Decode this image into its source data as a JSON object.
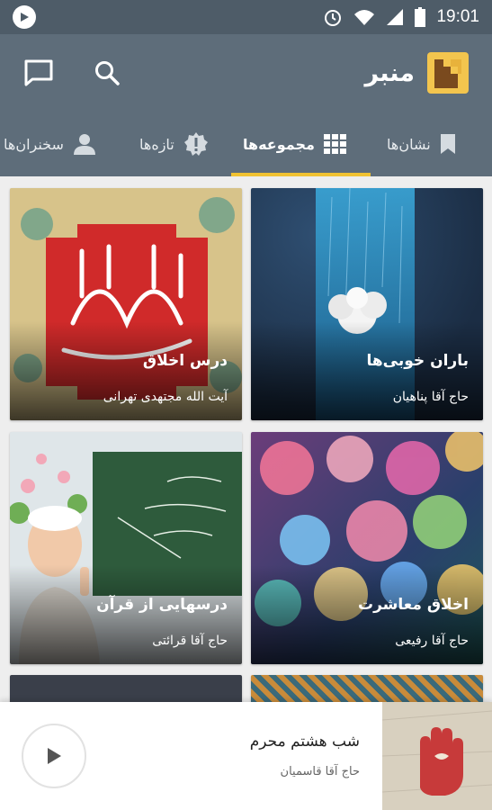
{
  "status_bar": {
    "time": "19:01"
  },
  "app": {
    "title": "منبر"
  },
  "tabs": [
    {
      "label": "نشان‌ها"
    },
    {
      "label": "مجموعه‌ها"
    },
    {
      "label": "تازه‌ها"
    },
    {
      "label": "سخنران‌ها"
    }
  ],
  "colors": {
    "toolbar": "#5e6d7a",
    "status_bar": "#4e5c68",
    "accent": "#f1c232"
  },
  "cards": [
    {
      "title": "باران خوبی‌ها",
      "subtitle": "حاج آقا پناهیان"
    },
    {
      "title": "درس اخلاق",
      "subtitle": "آیت الله مجتهدی تهرانی"
    },
    {
      "title": "اخلاق معاشرت",
      "subtitle": "حاج آقا رفیعی"
    },
    {
      "title": "درسهایی از قرآن",
      "subtitle": "حاج آقا قرائتی"
    }
  ],
  "player": {
    "title": "شب هشتم محرم",
    "subtitle": "حاج آقا قاسمیان"
  },
  "icons": [
    "play-circle-icon",
    "alarm-icon",
    "wifi-icon",
    "signal-icon",
    "battery-icon",
    "chat-icon",
    "search-icon",
    "bookmark-icon",
    "grid-icon",
    "new-icon",
    "person-icon",
    "play-icon"
  ]
}
